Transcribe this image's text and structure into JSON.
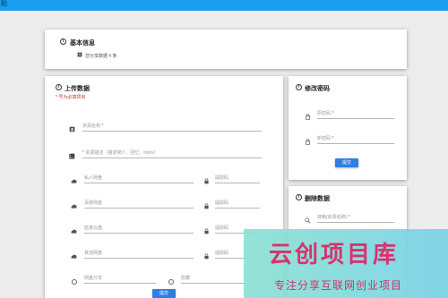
{
  "topbar": {
    "label": "贴"
  },
  "basic_info": {
    "title": "基本信息",
    "summary": "您分享数据 4 条"
  },
  "upload": {
    "title": "上传数据",
    "note": "* 号为必填项目",
    "name_placeholder": "资源名称",
    "desc_placeholder": "资源描述（描述简介、回忆、more）",
    "inputs": [
      {
        "placeholder": "私人网盘",
        "code_placeholder": "提取码"
      },
      {
        "placeholder": "百度网盘",
        "code_placeholder": "提取码"
      },
      {
        "placeholder": "蓝奏云盘",
        "code_placeholder": "提取码"
      },
      {
        "placeholder": "其他网盘",
        "code_placeholder": "提取码"
      }
    ],
    "radio_left": "网盘分享",
    "radio_right": "隐藏",
    "submit_label": "提交"
  },
  "password": {
    "title": "修改密码",
    "old_placeholder": "原密码",
    "new_placeholder": "新密码",
    "submit_label": "提交"
  },
  "delete": {
    "title": "删除数据",
    "search_placeholder": "搜索(资源名称)"
  },
  "watermark": {
    "line1": "云创项目库",
    "line2": "专注分享互联网创业项目"
  },
  "colors": {
    "accent": "#1a9ff0",
    "button": "#2f7ee6",
    "required": "#d9534f"
  }
}
